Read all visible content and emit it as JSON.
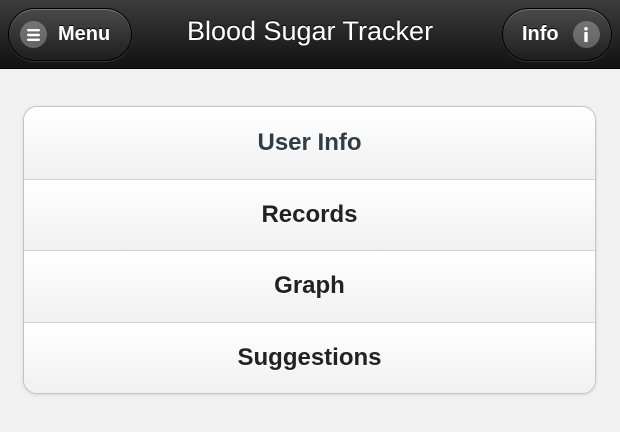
{
  "header": {
    "title": "Blood Sugar Tracker",
    "menu_label": "Menu",
    "info_label": "Info",
    "menu_icon": "hamburger-icon",
    "info_icon": "info-icon"
  },
  "nav": {
    "items": [
      {
        "label": "User Info"
      },
      {
        "label": "Records"
      },
      {
        "label": "Graph"
      },
      {
        "label": "Suggestions"
      }
    ]
  },
  "colors": {
    "header_bg": "#1e1e1e",
    "page_bg": "#f1f1f1",
    "item_text": "#222222",
    "active_item_text": "#2f3e46"
  }
}
